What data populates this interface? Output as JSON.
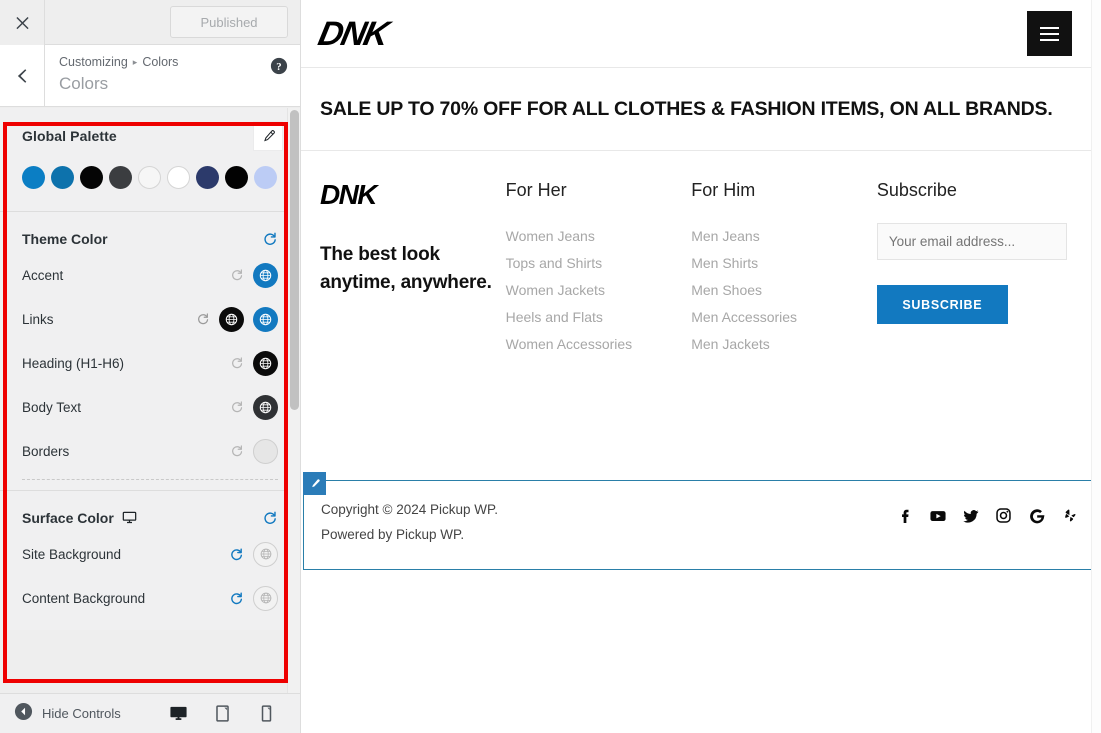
{
  "customizer": {
    "close_icon": "close-icon",
    "published_label": "Published",
    "back_icon": "chevron-left-icon",
    "help_icon": "help-icon",
    "breadcrumb_root": "Customizing",
    "breadcrumb_sep": "▸",
    "breadcrumb_current": "Colors",
    "section_title": "Colors",
    "global_palette": {
      "title": "Global Palette",
      "edit_icon": "pencil-icon",
      "swatches": [
        {
          "name": "palette-swatch-1",
          "color": "#0b7ec4"
        },
        {
          "name": "palette-swatch-2",
          "color": "#0d72ac"
        },
        {
          "name": "palette-swatch-3",
          "color": "#050505"
        },
        {
          "name": "palette-swatch-4",
          "color": "#3b3d40"
        },
        {
          "name": "palette-swatch-5",
          "color": "#f6f6f6"
        },
        {
          "name": "palette-swatch-6",
          "color": "#ffffff"
        },
        {
          "name": "palette-swatch-7",
          "color": "#2c3a6b"
        },
        {
          "name": "palette-swatch-8",
          "color": "#020202"
        },
        {
          "name": "palette-swatch-9",
          "color": "#bcccf5"
        }
      ]
    },
    "theme_color": {
      "title": "Theme Color",
      "reset_icon": "reset-icon",
      "rows": [
        {
          "label": "Accent",
          "name": "row-accent",
          "undo_active": false,
          "buttons": [
            {
              "name": "accent-color-button",
              "color": "#1279c0",
              "glyph": "globe-icon",
              "glyph_color": "#ffffff",
              "border": "none"
            }
          ]
        },
        {
          "label": "Links",
          "name": "row-links",
          "undo_active": true,
          "buttons": [
            {
              "name": "links-color-button-dark",
              "color": "#0b0b0b",
              "glyph": "globe-icon",
              "glyph_color": "#ffffff",
              "border": "none"
            },
            {
              "name": "links-color-button-accent",
              "color": "#1279c0",
              "glyph": "globe-icon",
              "glyph_color": "#ffffff",
              "border": "none"
            }
          ]
        },
        {
          "label": "Heading (H1-H6)",
          "name": "row-heading",
          "undo_active": false,
          "buttons": [
            {
              "name": "heading-color-button",
              "color": "#0b0b0b",
              "glyph": "globe-icon",
              "glyph_color": "#ffffff",
              "border": "none"
            }
          ]
        },
        {
          "label": "Body Text",
          "name": "row-body-text",
          "undo_active": false,
          "buttons": [
            {
              "name": "body-text-color-button",
              "color": "#2f3134",
              "glyph": "globe-icon",
              "glyph_color": "#ffffff",
              "border": "none"
            }
          ]
        },
        {
          "label": "Borders",
          "name": "row-borders",
          "undo_active": false,
          "buttons": [
            {
              "name": "borders-color-button",
              "color": "#e6e6e6",
              "glyph": "",
              "glyph_color": "#bcbcbc",
              "border": "1px solid #cfcfcf"
            }
          ]
        }
      ]
    },
    "surface_color": {
      "title": "Surface Color",
      "device_icon": "monitor-icon",
      "reset_icon": "reset-icon",
      "rows": [
        {
          "label": "Site Background",
          "name": "row-site-background",
          "undo_active": true,
          "buttons": [
            {
              "name": "site-background-color-button",
              "color": "#f2f2f2",
              "glyph": "globe-icon",
              "glyph_color": "#b5b5b5",
              "border": "1px solid #cfcfcf"
            }
          ]
        },
        {
          "label": "Content Background",
          "name": "row-content-background",
          "undo_active": true,
          "buttons": [
            {
              "name": "content-background-color-button",
              "color": "#f2f2f2",
              "glyph": "globe-icon",
              "glyph_color": "#b5b5b5",
              "border": "1px solid #cfcfcf"
            }
          ]
        }
      ]
    },
    "bottom_bar": {
      "hide_controls_label": "Hide Controls",
      "collapse_icon": "collapse-left-icon",
      "devices": [
        {
          "name": "device-desktop-button",
          "icon": "desktop-icon",
          "active": true
        },
        {
          "name": "device-tablet-button",
          "icon": "tablet-icon",
          "active": false
        },
        {
          "name": "device-mobile-button",
          "icon": "mobile-icon",
          "active": false
        }
      ]
    },
    "accent_color": "#1279c0",
    "highlight_color": "#ee0000"
  },
  "preview": {
    "header": {
      "logo_text": "DNK",
      "menu_icon": "hamburger-menu-icon"
    },
    "sale_banner": {
      "text": "SALE UP TO 70% OFF FOR ALL CLOTHES & FASHION ITEMS, ON ALL BRANDS."
    },
    "footer": {
      "brand": {
        "logo_text": "DNK",
        "tagline_line1": "The best look",
        "tagline_line2": "anytime, anywhere."
      },
      "columns": [
        {
          "name": "footer-column-for-her",
          "title": "For Her",
          "links": [
            "Women Jeans",
            "Tops and Shirts",
            "Women Jackets",
            "Heels and Flats",
            "Women Accessories"
          ]
        },
        {
          "name": "footer-column-for-him",
          "title": "For Him",
          "links": [
            "Men Jeans",
            "Men Shirts",
            "Men Shoes",
            "Men Accessories",
            "Men Jackets"
          ]
        }
      ],
      "subscribe": {
        "title": "Subscribe",
        "placeholder": "Your email address...",
        "input_value": "",
        "button_label": "SUBSCRIBE",
        "button_color": "#1279c0"
      }
    },
    "copyright": {
      "edit_icon": "pencil-icon",
      "line1": "Copyright © 2024 Pickup WP.",
      "line2": "Powered by Pickup WP.",
      "highlight_border_color": "#2a7fa8",
      "socials": [
        {
          "name": "social-facebook-icon",
          "label": "facebook-icon"
        },
        {
          "name": "social-youtube-icon",
          "label": "youtube-icon"
        },
        {
          "name": "social-twitter-icon",
          "label": "twitter-icon"
        },
        {
          "name": "social-instagram-icon",
          "label": "instagram-icon"
        },
        {
          "name": "social-google-icon",
          "label": "google-icon"
        },
        {
          "name": "social-yelp-icon",
          "label": "yelp-icon"
        }
      ]
    }
  }
}
